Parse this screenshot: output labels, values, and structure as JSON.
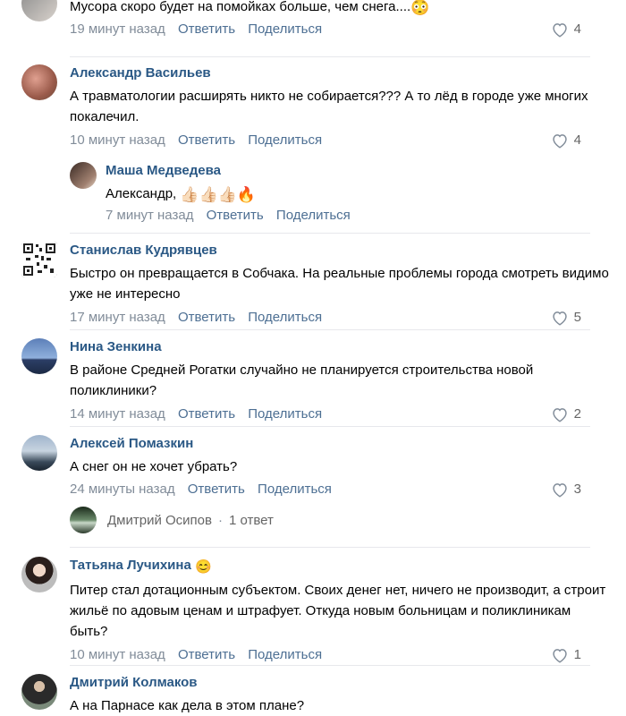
{
  "actions": {
    "reply": "Ответить",
    "share": "Поделиться"
  },
  "comments": [
    {
      "author": "",
      "text": "Мусора скоро будет на помойках больше, чем снега....",
      "emoji": "😳",
      "time": "19 минут назад",
      "likes": "4"
    },
    {
      "author": "Александр Васильев",
      "text": "А травматологии расширять никто не собирается??? А то лёд в городе уже многих покалечил.",
      "time": "10 минут назад",
      "likes": "4"
    },
    {
      "author": "Маша Медведева",
      "text": "Александр,",
      "emoji": "👍🏻👍🏻👍🏻🔥",
      "time": "7 минут назад",
      "likes": ""
    },
    {
      "author": "Станислав Кудрявцев",
      "text": "Быстро он превращается в Собчака. На реальные проблемы города смотреть видимо уже не интересно",
      "time": "17 минут назад",
      "likes": "5"
    },
    {
      "author": "Нина Зенкина",
      "text": "В районе Средней Рогатки случайно не планируется строительства новой поликлиники?",
      "time": "14 минут назад",
      "likes": "2"
    },
    {
      "author": "Алексей Помазкин",
      "text": "А снег он не хочет убрать?",
      "time": "24 минуты назад",
      "likes": "3"
    },
    {
      "author": "Татьяна Лучихина",
      "author_emoji": "😊",
      "text": "Питер стал дотационным субъектом. Своих денег нет, ничего не производит, а строит жильё по адовым ценам и штрафует. Откуда новым больницам и поликлиникам быть?",
      "time": "10 минут назад",
      "likes": "1"
    },
    {
      "author": "Дмитрий Колмаков",
      "text": "А на Парнасе как дела в этом плане?",
      "time": "",
      "likes": ""
    }
  ],
  "thread": {
    "author": "Дмитрий Осипов",
    "separator": "·",
    "replies": "1 ответ"
  },
  "icons": {
    "like": "heart-outline-icon"
  },
  "colors": {
    "author": "#2a5885",
    "meta": "#818c99",
    "link": "#4d6f93",
    "divider": "#e7e8ec"
  }
}
